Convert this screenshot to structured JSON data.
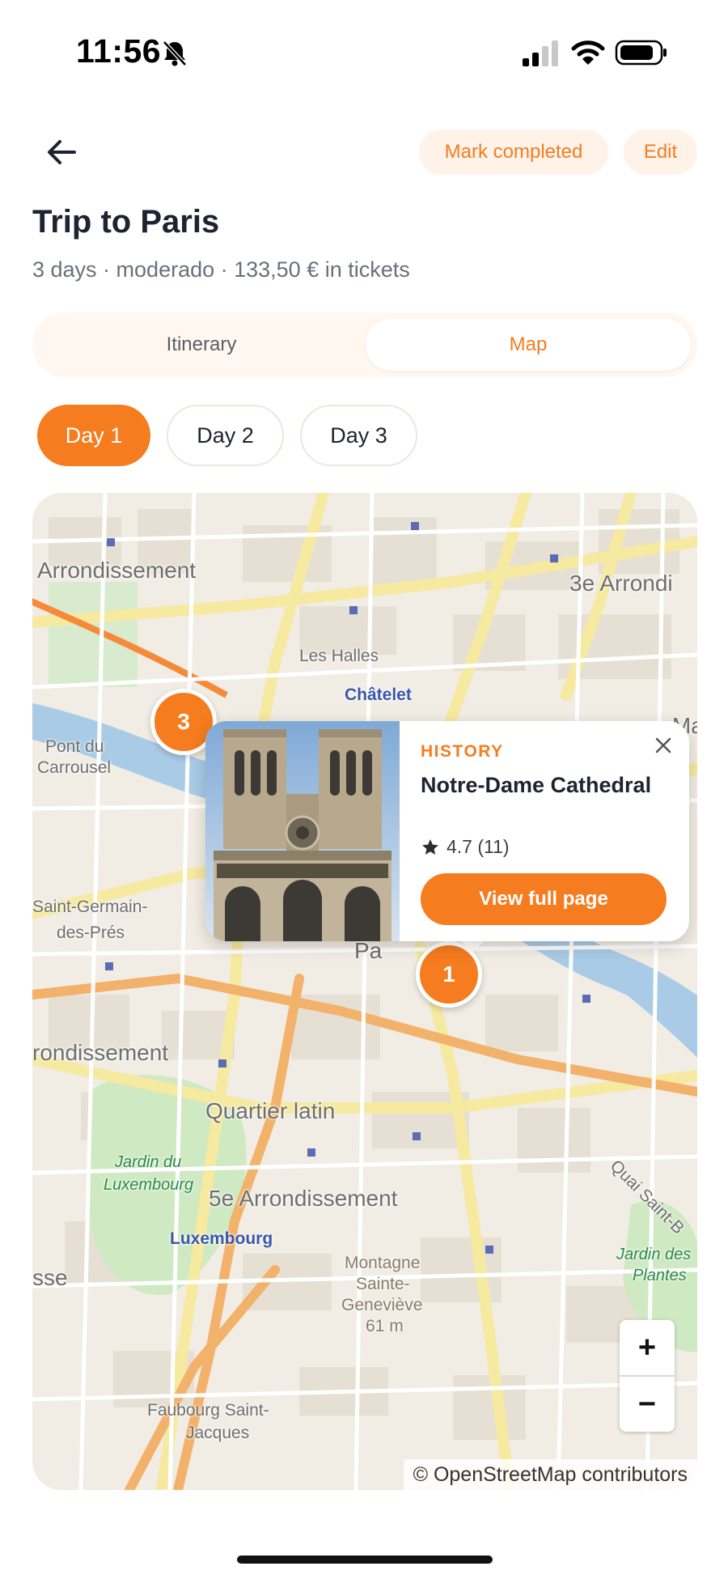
{
  "status_bar": {
    "time": "11:56"
  },
  "header": {
    "mark_completed_label": "Mark completed",
    "edit_label": "Edit"
  },
  "trip": {
    "title": "Trip to Paris",
    "subtitle": "3 days · moderado · 133,50 € in tickets"
  },
  "tabs": [
    {
      "label": "Itinerary",
      "selected": false
    },
    {
      "label": "Map",
      "selected": true
    }
  ],
  "days": [
    {
      "label": "Day 1",
      "selected": true
    },
    {
      "label": "Day 2",
      "selected": false
    },
    {
      "label": "Day 3",
      "selected": false
    }
  ],
  "map": {
    "labels": [
      "Arrondissement",
      "3e Arrondi",
      "Les Halles",
      "Châtelet",
      "Pont du",
      "Carrousel",
      "Saint-Germain-",
      "des-Prés",
      "rondissement",
      "Quartier latin",
      "Jardin du",
      "Luxembourg",
      "5e Arrondissement",
      "Luxembourg",
      "Montagne",
      "Sainte-",
      "Geneviève",
      "61 m",
      "Jardin des",
      "Plantes",
      "Faubourg Saint-",
      "Jacques",
      "Quai Saint-B",
      "Pa",
      "sse",
      "e-Ma"
    ],
    "markers": [
      {
        "number": "3"
      },
      {
        "number": "1"
      }
    ],
    "zoom_in": "+",
    "zoom_out": "−",
    "attribution": "© OpenStreetMap contributors"
  },
  "popup": {
    "category": "HISTORY",
    "title": "Notre-Dame Cathedral",
    "rating": "4.7 (11)",
    "cta": "View full page"
  },
  "colors": {
    "accent": "#f57c1f",
    "accent_soft": "#fff3e9"
  }
}
